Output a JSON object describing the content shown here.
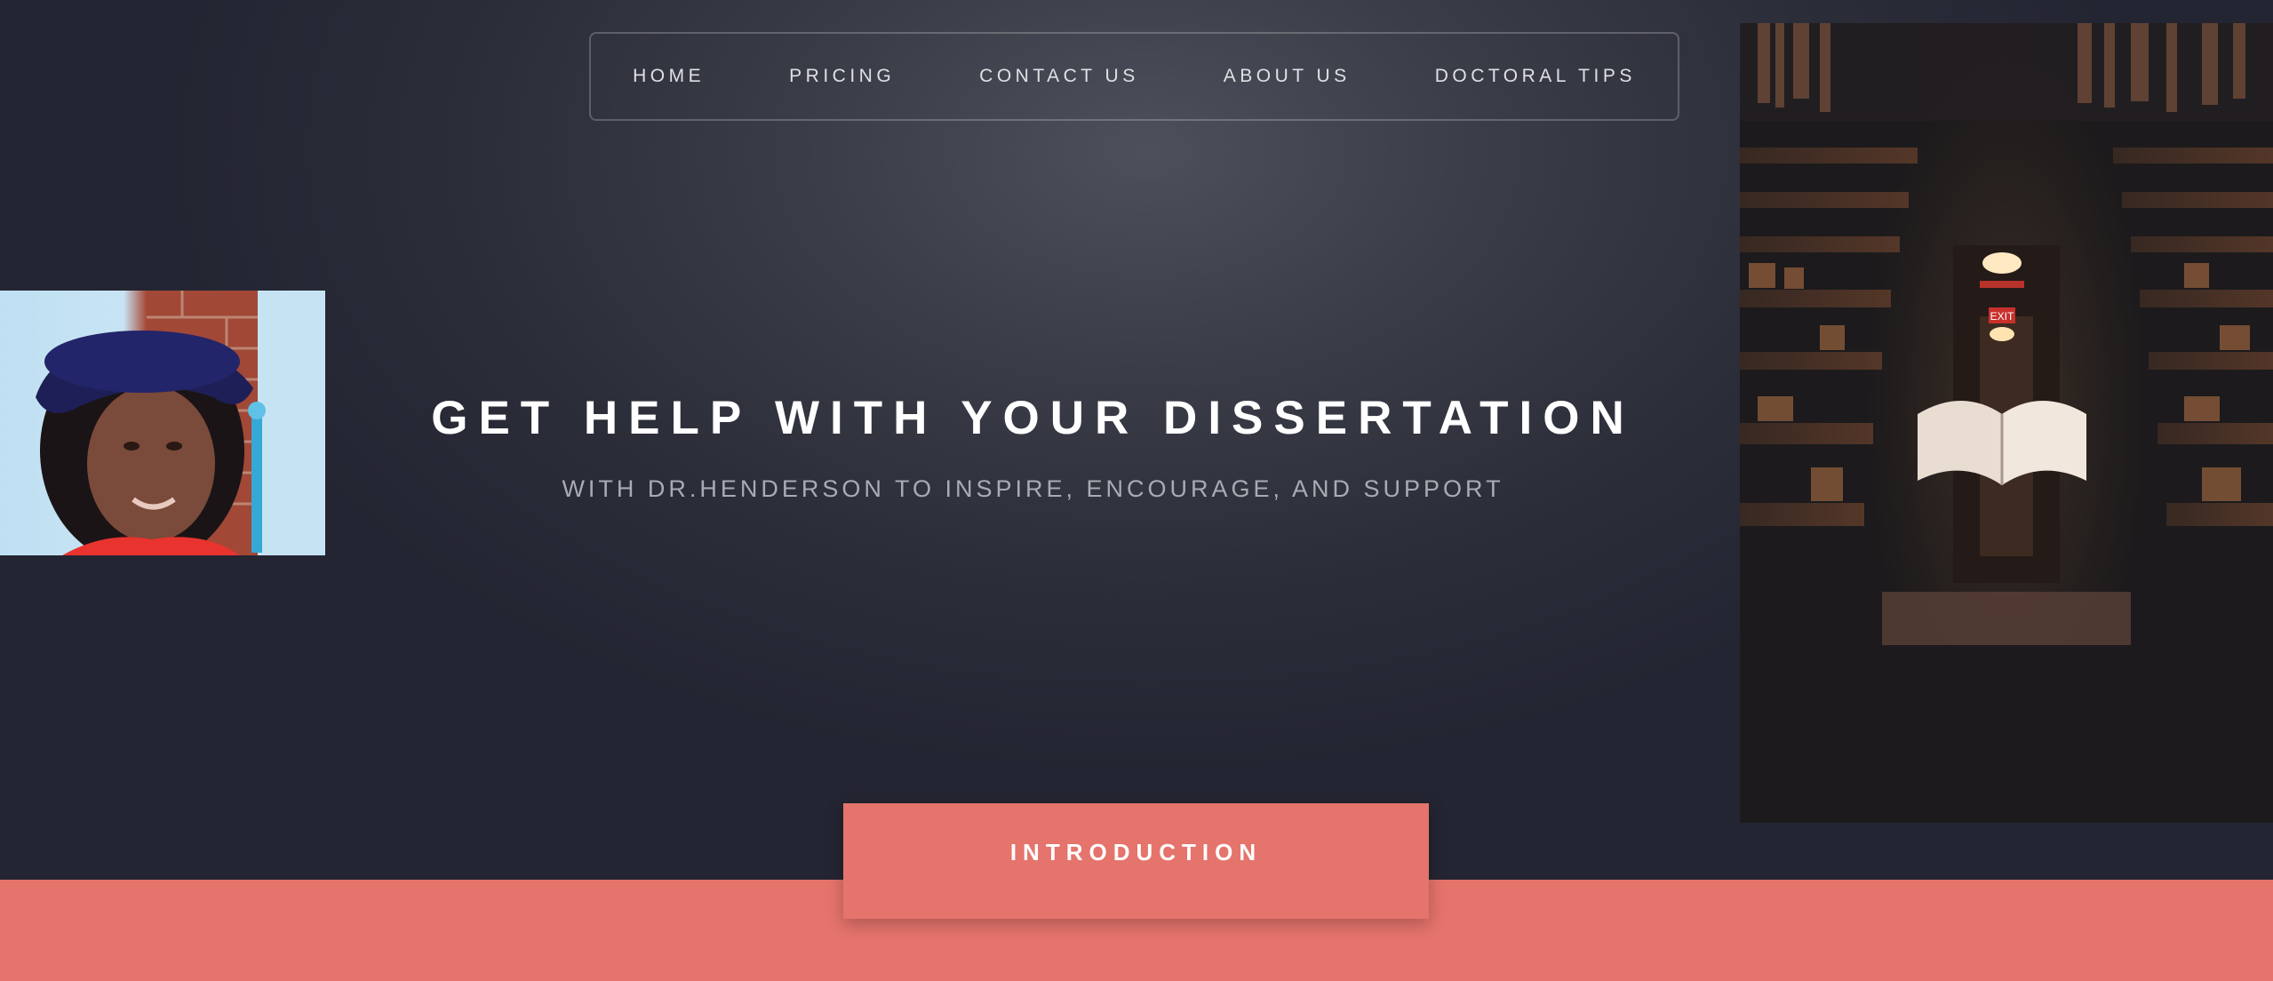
{
  "nav": {
    "items": [
      {
        "label": "HOME"
      },
      {
        "label": "PRICING"
      },
      {
        "label": "CONTACT US"
      },
      {
        "label": "ABOUT US"
      },
      {
        "label": "DOCTORAL TIPS"
      }
    ]
  },
  "hero": {
    "headline": "GET HELP WITH YOUR DISSERTATION",
    "subheadline": "WITH DR.HENDERSON TO INSPIRE, ENCOURAGE, AND SUPPORT",
    "portrait_alt": "Dr. Henderson in graduation cap",
    "library_alt": "Library with floating open book",
    "library_sign": "EXIT"
  },
  "intro": {
    "label": "INTRODUCTION"
  },
  "colors": {
    "background": "#2b2d39",
    "accent": "#e5746c",
    "nav_text": "#dfe0e4",
    "subheadline": "#a9abb4"
  }
}
